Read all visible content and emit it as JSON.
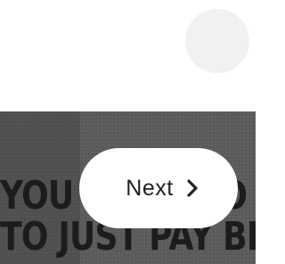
{
  "headline": {
    "line1": "YOU WANT TO EARN",
    "line2": "TO JUST PAY BILLS"
  },
  "next_button": {
    "label": "Next",
    "icon": "chevron-right-icon"
  },
  "colors": {
    "background_top": "#ffffff",
    "overlay_dark": "#5a5a5a",
    "button_bg": "#ffffff",
    "button_text": "#222222",
    "headline_text": "#1c1c1c",
    "corner_circle": "#f1f1f1"
  }
}
